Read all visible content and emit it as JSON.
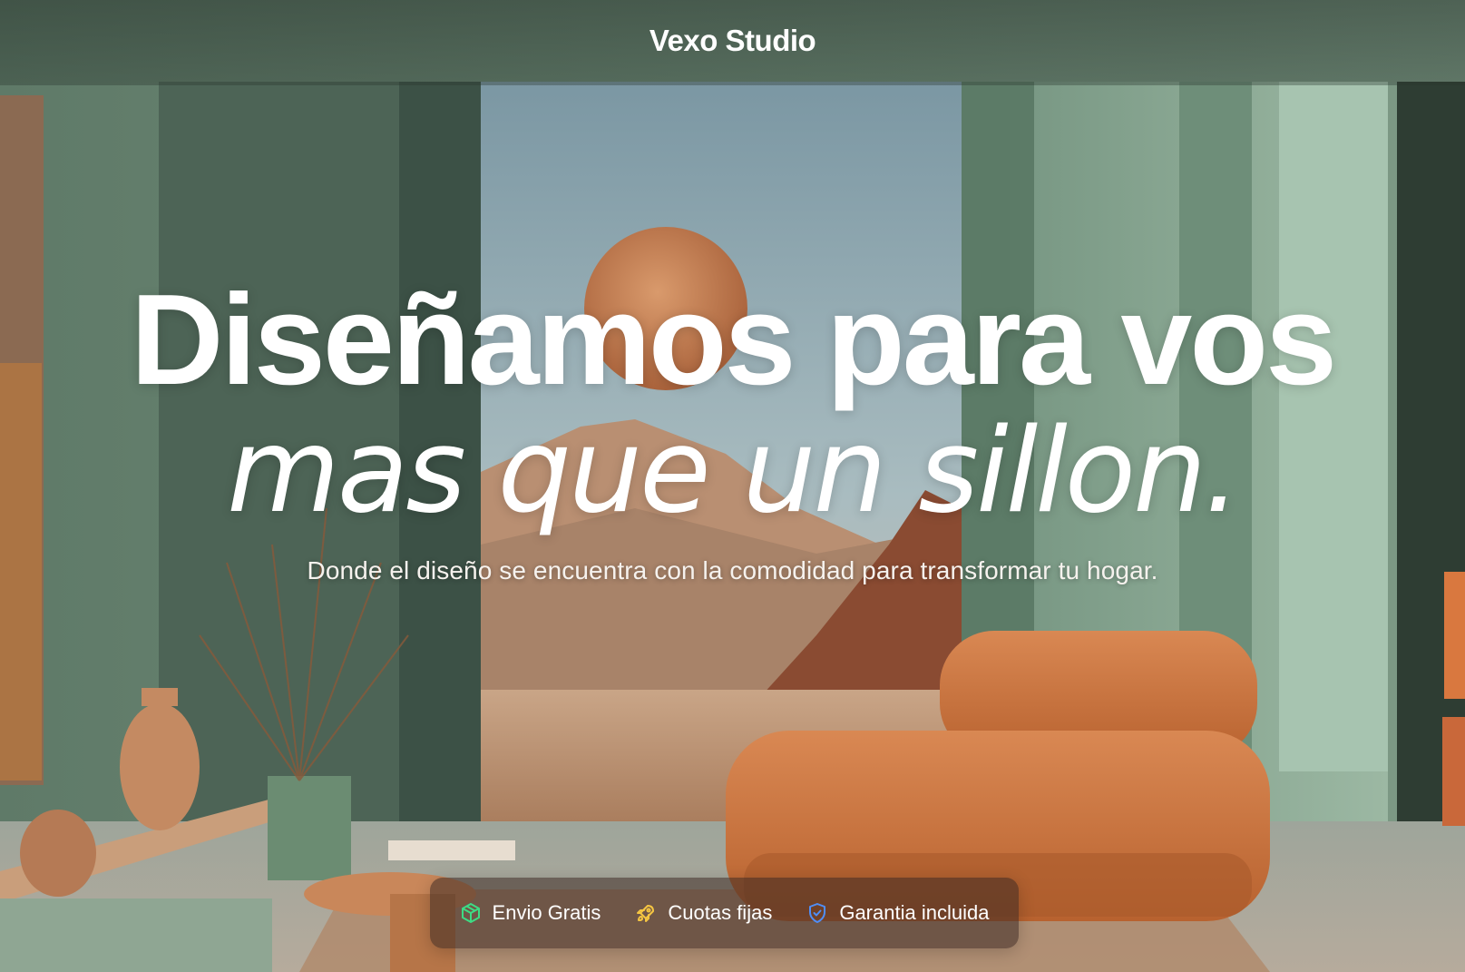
{
  "header": {
    "brand": "Vexo Studio"
  },
  "hero": {
    "headline": "Diseñamos para vos",
    "headline_italic": "mas que un sillon.",
    "subtitle": "Donde el diseño se encuentra con la comodidad para transformar tu hogar."
  },
  "features": [
    {
      "label": "Envio Gratis",
      "icon": "package-icon",
      "color": "#3ddc84"
    },
    {
      "label": "Cuotas fijas",
      "icon": "rocket-icon",
      "color": "#f5c542"
    },
    {
      "label": "Garantia incluida",
      "icon": "shield-check-icon",
      "color": "#4f8ef7"
    }
  ]
}
